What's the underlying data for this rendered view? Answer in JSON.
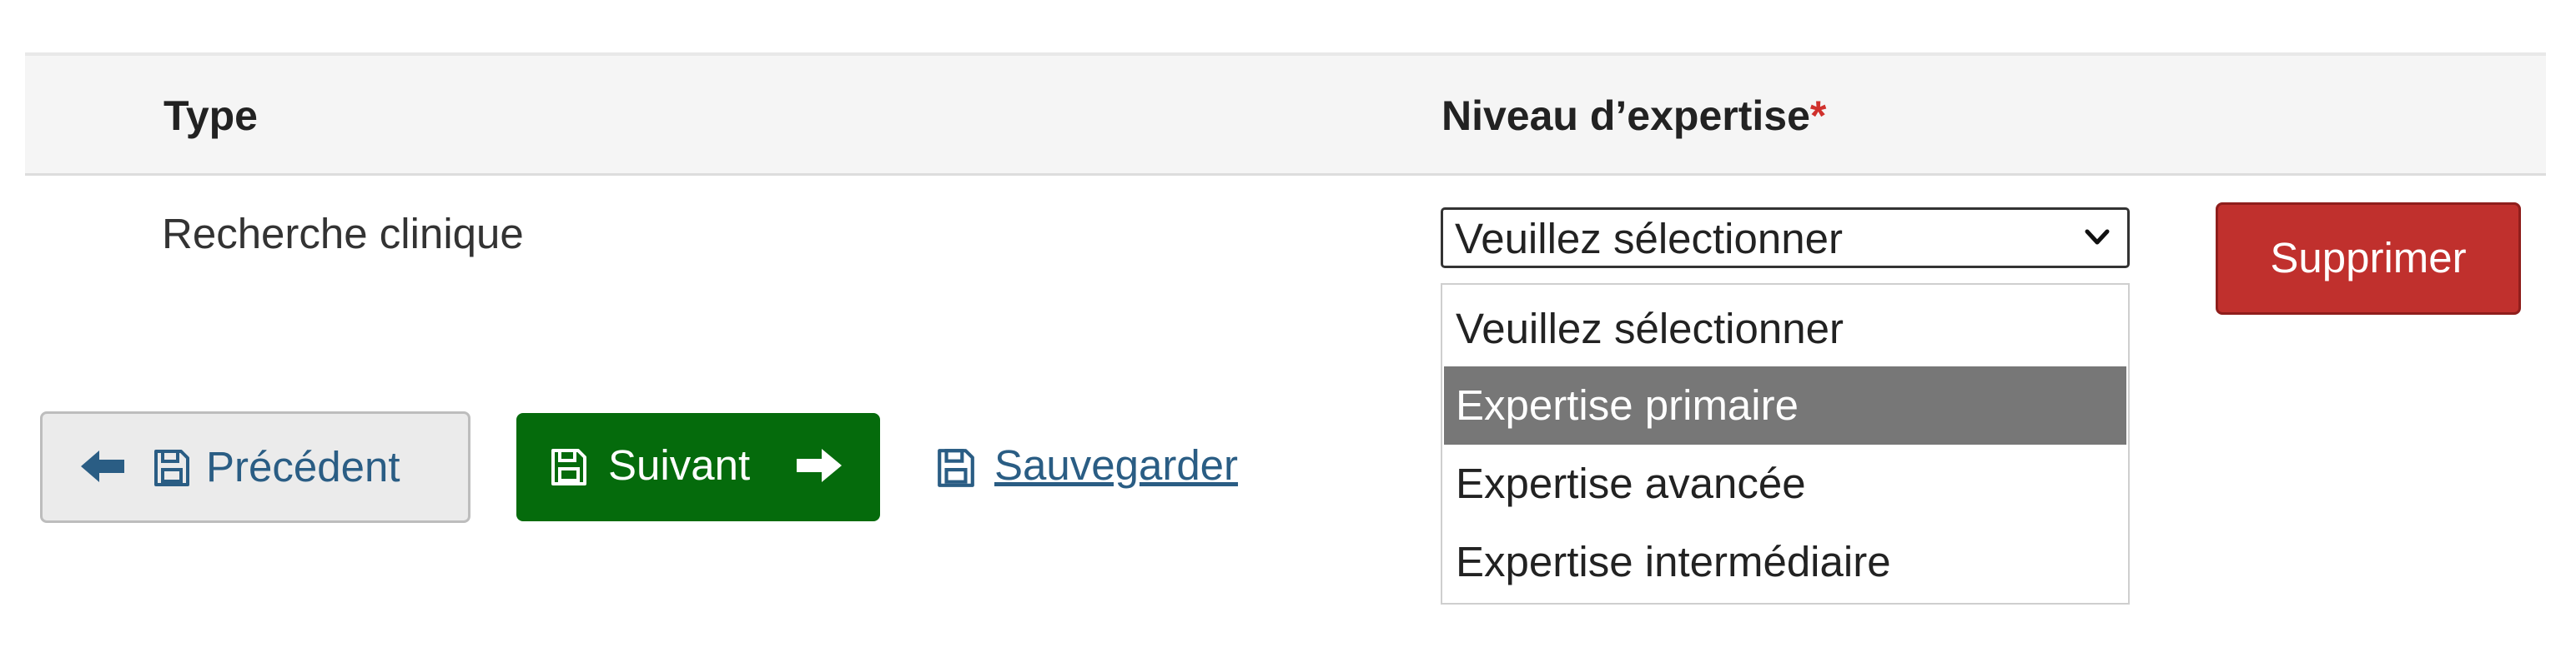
{
  "table": {
    "headers": {
      "type": "Type",
      "level": "Niveau d’expertise",
      "required_mark": "*"
    },
    "row": {
      "type_value": "Recherche clinique",
      "level_select": {
        "value": "Veuillez sélectionner",
        "options": [
          "Veuillez sélectionner",
          "Expertise primaire",
          "Expertise avancée",
          "Expertise intermédiaire"
        ],
        "highlighted_index": 1
      },
      "delete_label": "Supprimer"
    }
  },
  "navigation": {
    "previous_label": "Précédent",
    "next_label": "Suivant",
    "save_label": "Sauvegarder"
  },
  "icons": {
    "previous": [
      "arrow-left-icon",
      "floppy-disk-icon"
    ],
    "next": [
      "floppy-disk-icon",
      "arrow-right-icon"
    ],
    "save": "floppy-disk-icon",
    "select": "chevron-down-icon"
  },
  "colors": {
    "delete_button": "#c0302d",
    "next_button": "#056b0c",
    "link_blue": "#2a5d84",
    "highlight_option": "#777777",
    "required_star": "#d0312d"
  }
}
